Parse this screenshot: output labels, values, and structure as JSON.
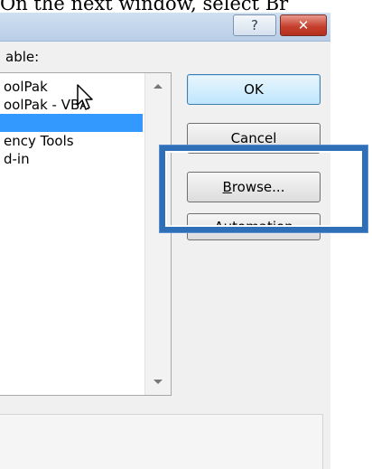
{
  "caption": "On the next window, select Br",
  "titlebar": {
    "help_glyph": "?",
    "close_glyph": "✕"
  },
  "list": {
    "label": "able:",
    "items": [
      {
        "text": "oolPak",
        "selected": false
      },
      {
        "text": "oolPak - VBA",
        "selected": false
      },
      {
        "text": "",
        "selected": true
      },
      {
        "text": "ency Tools",
        "selected": false
      },
      {
        "text": "d-in",
        "selected": false
      }
    ]
  },
  "buttons": {
    "ok": "OK",
    "cancel": "Cancel",
    "browse_prefix": "B",
    "browse_rest": "rowse...",
    "automation": "Automation"
  },
  "colors": {
    "selection": "#3399ff",
    "highlight_frame": "#2f6fb8"
  },
  "icons": {
    "cursor": "arrow-pointer-icon"
  }
}
